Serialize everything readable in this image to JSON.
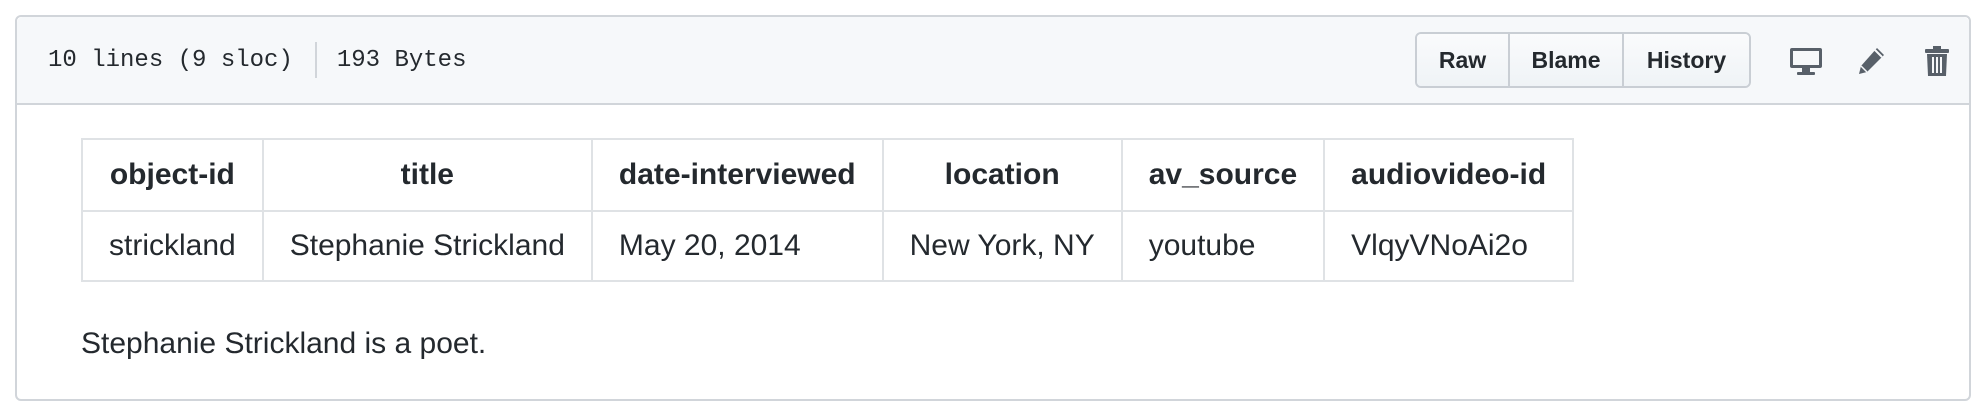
{
  "file_header": {
    "lines": "10 lines (9 sloc)",
    "size": "193 Bytes",
    "buttons": {
      "raw": "Raw",
      "blame": "Blame",
      "history": "History"
    },
    "icons": [
      "desktop-icon",
      "pencil-icon",
      "trash-icon"
    ]
  },
  "table": {
    "headers": [
      "object-id",
      "title",
      "date-interviewed",
      "location",
      "av_source",
      "audiovideo-id"
    ],
    "rows": [
      [
        "strickland",
        "Stephanie Strickland",
        "May 20, 2014",
        "New York, NY",
        "youtube",
        "VlqyVNoAi2o"
      ]
    ]
  },
  "description": "Stephanie Strickland is a poet.",
  "colors": {
    "header_bg": "#f6f8fa",
    "border": "#d1d5da",
    "text": "#24292e",
    "icon": "#586069"
  }
}
